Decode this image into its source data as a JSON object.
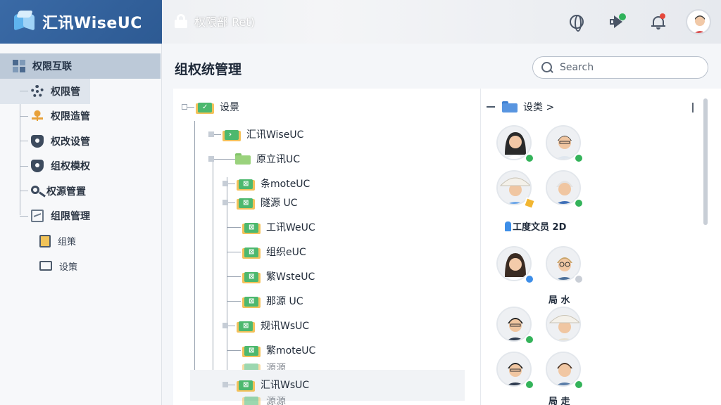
{
  "app": {
    "brand": "汇讯WiseUC",
    "section_title": "权限部 Ret)"
  },
  "colors": {
    "brand": "#2d5a93",
    "accent": "#3d8ee8",
    "online": "#34b35a"
  },
  "sidebar": {
    "root": "权限互联",
    "items": [
      {
        "label": "权限管",
        "icon": "gear-icon"
      },
      {
        "label": "权限造管",
        "icon": "org-icon"
      },
      {
        "label": "权改设管",
        "icon": "shield-icon"
      },
      {
        "label": "组权模权",
        "icon": "shield-icon"
      },
      {
        "label": "权源管置",
        "icon": "key-icon"
      },
      {
        "label": "组限管理",
        "icon": "chart-icon"
      }
    ],
    "subitems": [
      {
        "label": "组策",
        "icon": "clipboard-icon"
      },
      {
        "label": "设策",
        "icon": "folder-open-icon"
      }
    ]
  },
  "main": {
    "title": "组权统管理",
    "search": {
      "placeholder": "Search",
      "value": ""
    },
    "tree": {
      "root": "设景",
      "level1": "汇讯WiseUC",
      "level2": "原立讯UC",
      "children": [
        "条moteUC",
        "隧源 UC",
        "工讯WeUC",
        "组织eUC",
        "繁WsteUC",
        "那源 UC",
        "规讯WsUC",
        "繁moteUC",
        "源源",
        "汇讯WsUC",
        "源源"
      ]
    },
    "list": {
      "header": "设类 >",
      "labels": [
        "工度文员 2D",
        "局 水",
        "局 走"
      ]
    }
  }
}
